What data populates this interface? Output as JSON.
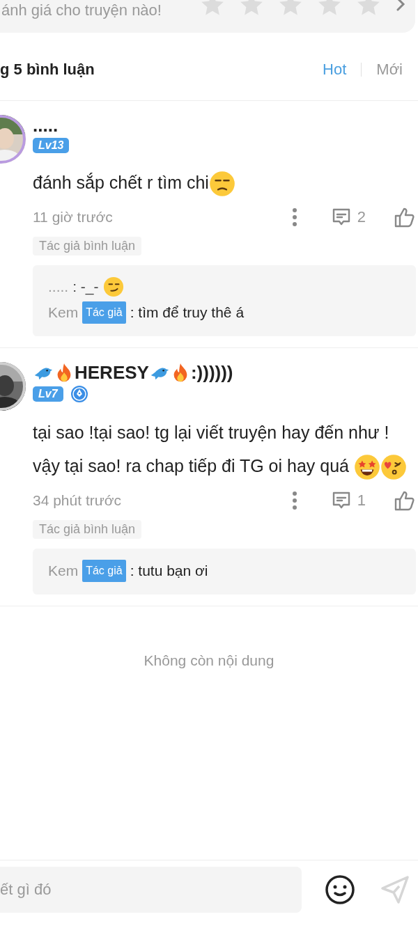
{
  "rating": {
    "prompt": "ánh giá cho truyện nào!",
    "stars": 0
  },
  "comments_header": {
    "title": "g 5 bình luận",
    "sort_tabs": [
      {
        "label": "Hot",
        "selected": true
      },
      {
        "label": "Mới",
        "selected": false
      }
    ]
  },
  "comments": [
    {
      "name": [
        {
          "kind": "text",
          "text": "....."
        }
      ],
      "level": "Lv13",
      "author_badge": false,
      "body": [
        {
          "kind": "text",
          "text": "đánh sắp chết r tìm chi"
        },
        {
          "kind": "unamused"
        }
      ],
      "time": "11 giờ trước",
      "reply_count": "2",
      "tag": "Tác giả bình luận",
      "replies": [
        {
          "name": ".....",
          "text": [
            {
              "kind": "text",
              "text": ": -_- "
            },
            {
              "kind": "smirk"
            }
          ]
        },
        {
          "name": "Kem",
          "author_label": "Tác giả",
          "text": [
            {
              "kind": "text",
              "text": ": tìm để truy thê á"
            }
          ]
        }
      ]
    },
    {
      "name": [
        {
          "kind": "bird"
        },
        {
          "kind": "fire"
        },
        {
          "kind": "text",
          "text": "HERESY"
        },
        {
          "kind": "bird"
        },
        {
          "kind": "fire"
        },
        {
          "kind": "text",
          "text": ":))))))"
        }
      ],
      "level": "Lv7",
      "author_badge": true,
      "body": [
        {
          "kind": "text",
          "text": "tại sao !tại sao! tg lại viết truyện hay đến như ! vậy tại sao! ra chap tiếp đi TG oi hay quá "
        },
        {
          "kind": "starstruck"
        },
        {
          "kind": "kiss"
        }
      ],
      "time": "34 phút trước",
      "reply_count": "1",
      "tag": "Tác giả bình luận",
      "replies": [
        {
          "name": "Kem",
          "author_label": "Tác giả",
          "text": [
            {
              "kind": "text",
              "text": ": tutu bạn ơi"
            }
          ]
        }
      ]
    }
  ],
  "end_note": "Không còn nội dung",
  "composer": {
    "placeholder": "ết gì đó"
  }
}
